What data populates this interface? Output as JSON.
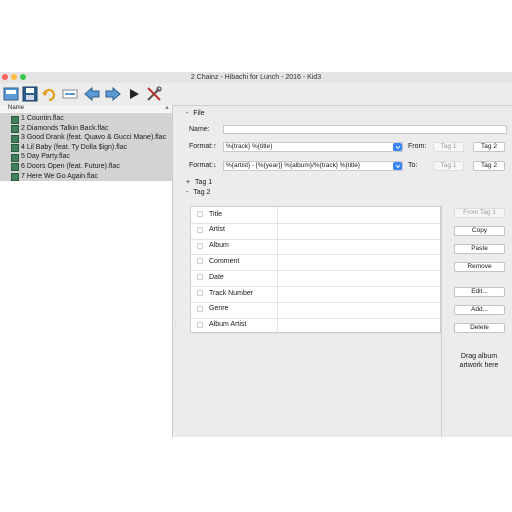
{
  "window": {
    "title": "2 Chainz - Hibachi for Lunch - 2016 - Kid3",
    "traffic_colors": {
      "close": "#fc605c",
      "minimize": "#fdbc40",
      "zoom": "#34c84a"
    }
  },
  "toolbar": {
    "icons": [
      "new-icon",
      "save-icon",
      "revert-icon",
      "select-all-icon",
      "previous-icon",
      "next-icon",
      "play-icon",
      "settings-icon"
    ]
  },
  "filelist": {
    "header": "Name",
    "items": [
      "1 Countin.flac",
      "2 Diamonds Talkin Back.flac",
      "3 Good Drank (feat. Quavo & Gucci Mane).flac",
      "4 Lil Baby (feat. Ty Dolla $ign).flac",
      "5 Day Party.flac",
      "6 Doors Open (feat. Future).flac",
      "7 Here We Go Again.flac"
    ]
  },
  "file_section": {
    "toggle": "-",
    "title": "File",
    "name_label": "Name:",
    "name_value": "",
    "format_up_label": "Format:↑",
    "format_up_value": "%{track} %{title}",
    "format_down_label": "Format:↓",
    "format_down_value": "%{artist} - [%{year}] %{album}/%{track} %{title}",
    "from_label": "From:",
    "to_label": "To:",
    "from_tag1": "Tag 1",
    "from_tag2": "Tag 2",
    "to_tag1": "Tag 1",
    "to_tag2": "Tag 2"
  },
  "tag1": {
    "toggle": "+",
    "title": "Tag 1"
  },
  "tag2": {
    "toggle": "-",
    "title": "Tag 2",
    "fields": [
      "Title",
      "Artist",
      "Album",
      "Comment",
      "Date",
      "Track Number",
      "Genre",
      "Album Artist"
    ],
    "buttons": {
      "from_tag1": "From Tag 1",
      "copy": "Copy",
      "paste": "Paste",
      "remove": "Remove",
      "edit": "Edit...",
      "add": "Add...",
      "delete": "Delete"
    },
    "artwork": "Drag album artwork here"
  }
}
